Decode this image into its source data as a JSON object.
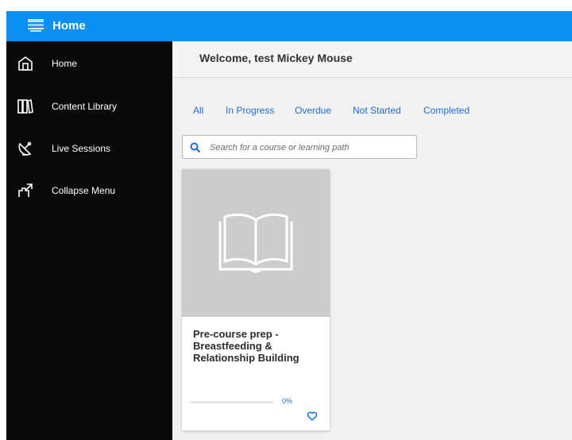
{
  "header": {
    "title": "Home"
  },
  "sidebar": {
    "items": [
      {
        "label": "Home",
        "icon": "home-icon"
      },
      {
        "label": "Content Library",
        "icon": "library-icon"
      },
      {
        "label": "Live Sessions",
        "icon": "satellite-dish-icon"
      },
      {
        "label": "Collapse Menu",
        "icon": "collapse-icon"
      }
    ]
  },
  "main": {
    "welcome": "Welcome, test Mickey Mouse",
    "tabs": [
      "All",
      "In Progress",
      "Overdue",
      "Not Started",
      "Completed"
    ],
    "search": {
      "placeholder": "Search for a course or learning path"
    },
    "courses": [
      {
        "title": "Pre-course prep - Breastfeeding & Relationship Building",
        "progress_text": "0%",
        "progress": 0
      }
    ]
  },
  "colors": {
    "header_blue": "#0a8ff2",
    "sidebar_black": "#0a0a0a",
    "link_blue": "#1a6fd1",
    "background": "#f1f1f1"
  }
}
